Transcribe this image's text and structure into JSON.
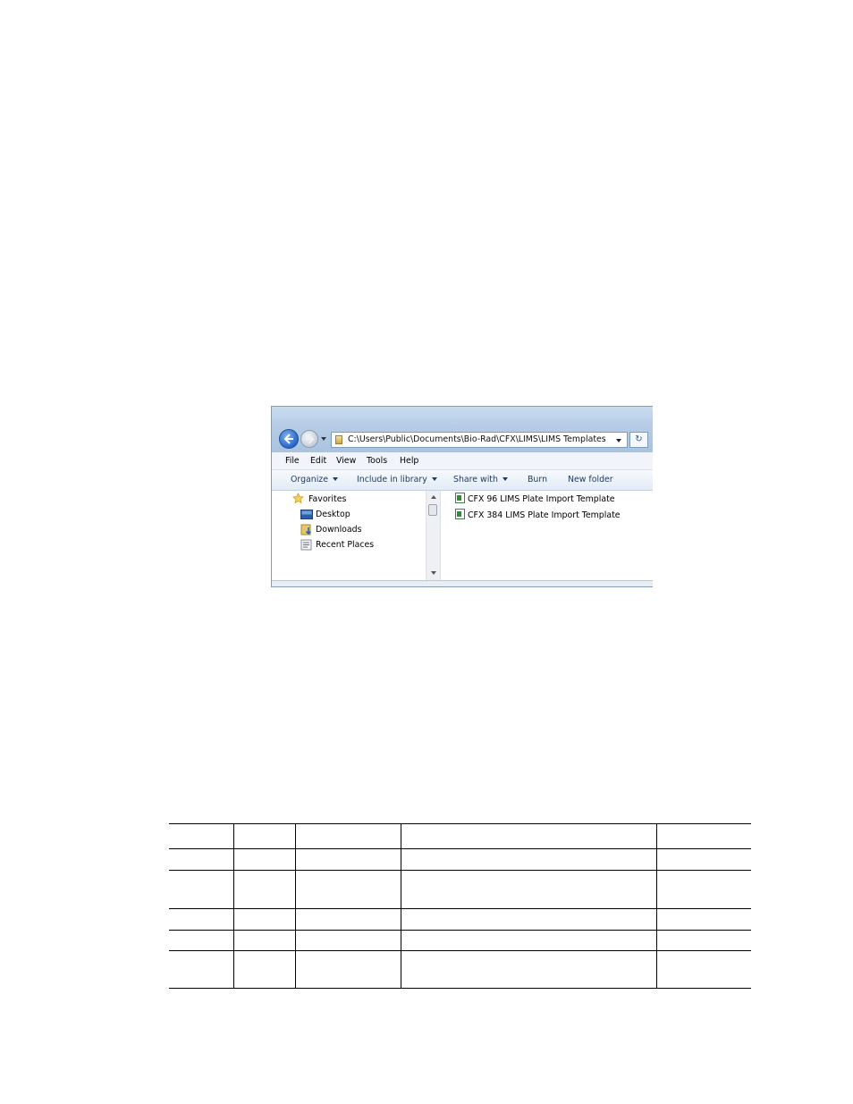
{
  "explorer": {
    "address_path": "C:\\Users\\Public\\Documents\\Bio-Rad\\CFX\\LIMS\\LIMS Templates",
    "menu": [
      "File",
      "Edit",
      "View",
      "Tools",
      "Help"
    ],
    "commands": {
      "organize": "Organize",
      "include_in_library": "Include in library",
      "share_with": "Share with",
      "burn": "Burn",
      "new_folder": "New folder"
    },
    "navigation": {
      "favorites": "Favorites",
      "desktop": "Desktop",
      "downloads": "Downloads",
      "recent_places": "Recent Places"
    },
    "files": [
      "CFX 96 LIMS Plate Import Template",
      "CFX 384 LIMS Plate Import Template"
    ]
  }
}
